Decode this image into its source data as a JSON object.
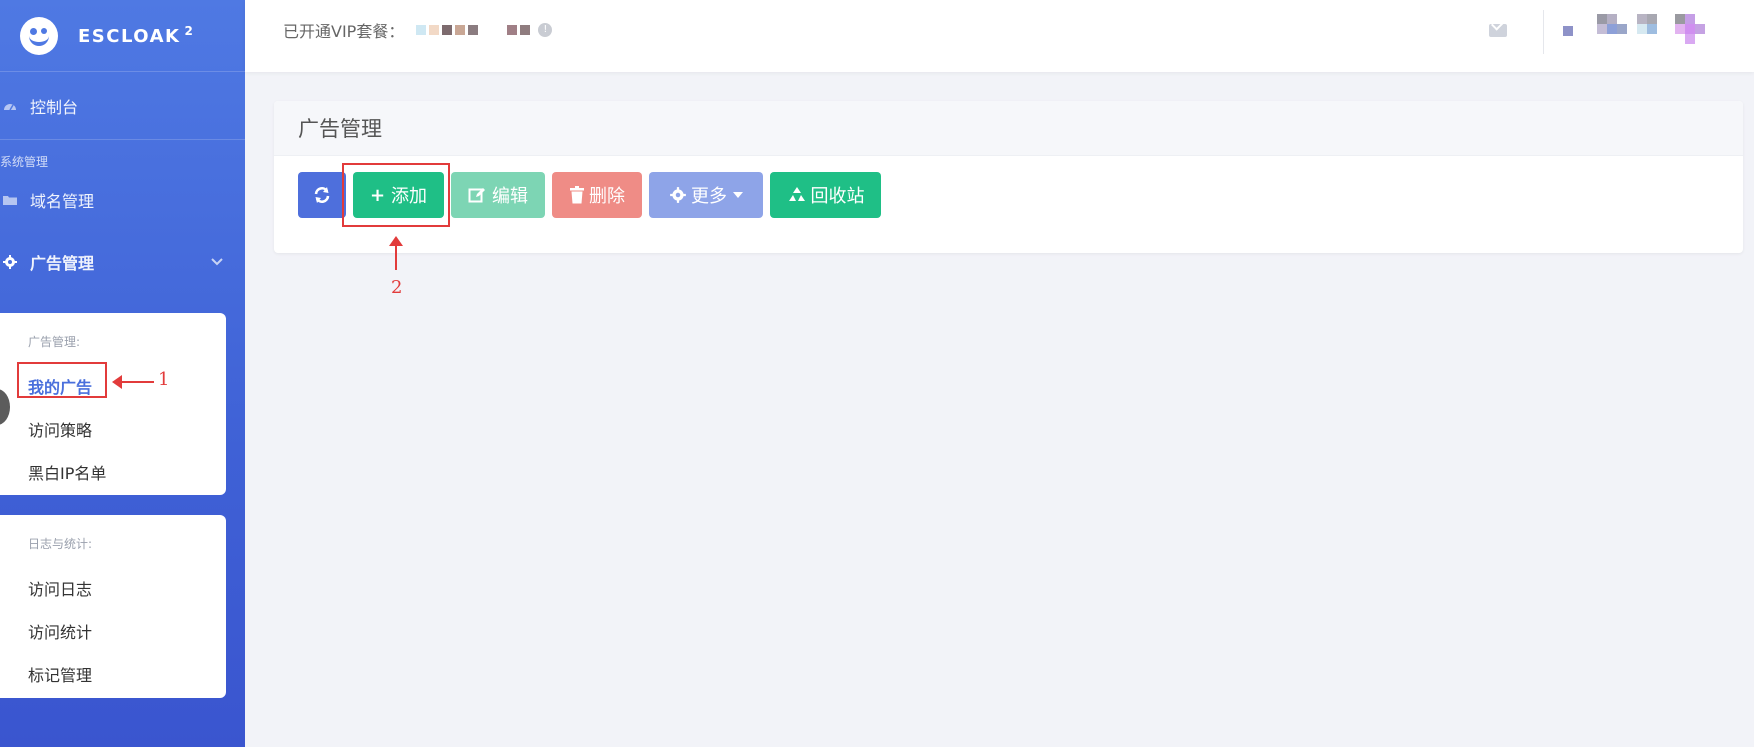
{
  "brand": {
    "name": "ESCLOAK",
    "version": "2"
  },
  "sidebar": {
    "console": "控制台",
    "system_section": "系统管理",
    "domain": "域名管理",
    "ads": "广告管理",
    "ads_submenu": {
      "title": "广告管理:",
      "items": [
        "我的广告",
        "访问策略",
        "黑白IP名单"
      ]
    },
    "logs_submenu": {
      "title": "日志与统计:",
      "items": [
        "访问日志",
        "访问统计",
        "标记管理"
      ]
    }
  },
  "header": {
    "vip_text": "已开通VIP套餐：",
    "info": "!"
  },
  "panel": {
    "title": "广告管理",
    "buttons": {
      "add": "添加",
      "edit": "编辑",
      "delete": "删除",
      "more": "更多",
      "recycle": "回收站"
    }
  },
  "annotations": {
    "one": "1",
    "two": "2"
  },
  "colors": {
    "sidebar": "#4f79e3",
    "primary": "#4e6fdc",
    "success": "#1fbf86",
    "danger": "#ef8c86",
    "annotation": "#e23b3b"
  }
}
